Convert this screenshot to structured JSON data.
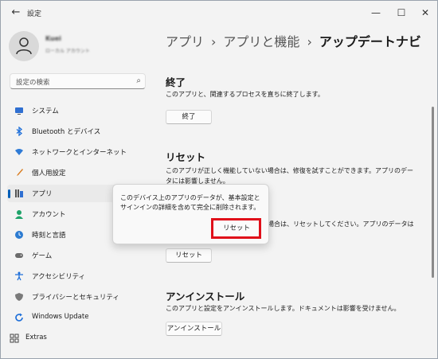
{
  "window": {
    "title": "設定"
  },
  "profile": {
    "name": "Kuei",
    "subtitle": "ローカル アカウント"
  },
  "search": {
    "placeholder": "設定の検索"
  },
  "nav": [
    {
      "label": "システム",
      "icon": "monitor-icon",
      "color": "#2f6fd1"
    },
    {
      "label": "Bluetooth とデバイス",
      "icon": "bluetooth-icon",
      "color": "#1e6fd9"
    },
    {
      "label": "ネットワークとインターネット",
      "icon": "wifi-icon",
      "color": "#2f7bd6"
    },
    {
      "label": "個人用設定",
      "icon": "brush-icon",
      "color": "#d97b1e"
    },
    {
      "label": "アプリ",
      "icon": "apps-icon",
      "color": "#555555"
    },
    {
      "label": "アカウント",
      "icon": "person-icon",
      "color": "#1fa36a"
    },
    {
      "label": "時刻と言語",
      "icon": "globe-clock-icon",
      "color": "#2c7bd1"
    },
    {
      "label": "ゲーム",
      "icon": "gamepad-icon",
      "color": "#6b6b6b"
    },
    {
      "label": "アクセシビリティ",
      "icon": "accessibility-icon",
      "color": "#1e6fd9"
    },
    {
      "label": "プライバシーとセキュリティ",
      "icon": "shield-icon",
      "color": "#7a7a7a"
    },
    {
      "label": "Windows Update",
      "icon": "update-icon",
      "color": "#1e6fd9"
    },
    {
      "label": "Extras",
      "icon": "extras-icon",
      "color": "#444444"
    }
  ],
  "breadcrumb": {
    "item1": "アプリ",
    "item2": "アプリと機能",
    "current": "アップデートナビ",
    "sep": "›"
  },
  "terminate": {
    "heading": "終了",
    "desc": "このアプリと、関連するプロセスを直ちに終了します。",
    "button": "終了"
  },
  "reset": {
    "heading": "リセット",
    "desc_line1": "このアプリが正しく機能していない場合は、修復を試すことができます。アプリのデー",
    "desc_line2": "タには影響しません。",
    "desc_line3": "場合は、リセットしてください。アプリのデータは",
    "button": "リセット"
  },
  "uninstall": {
    "heading": "アンインストール",
    "desc": "このアプリと設定をアンインストールします。ドキュメントは影響を受けません。",
    "button": "アンインストール"
  },
  "flyout": {
    "text": "このデバイス上のアプリのデータが、基本設定とサインインの詳細を含めて完全に削除されます。",
    "button": "リセット"
  }
}
